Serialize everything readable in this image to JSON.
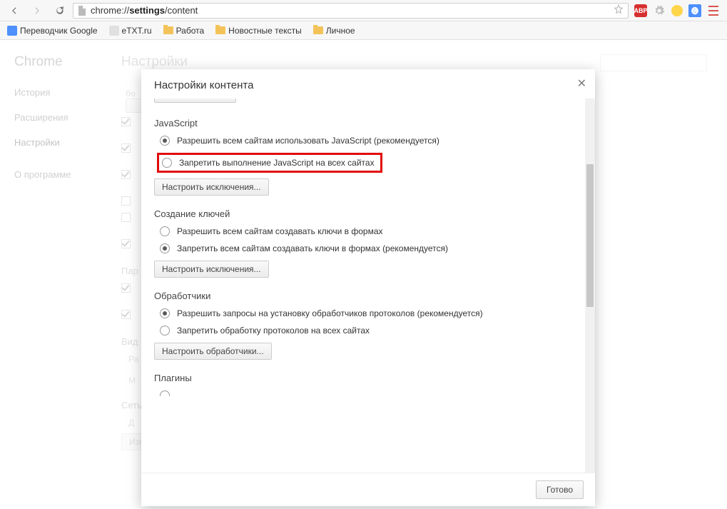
{
  "browser": {
    "url_prefix": "chrome://",
    "url_bold": "settings",
    "url_suffix": "/content",
    "ext_abp_label": "ABP",
    "ext_translate_label": "G"
  },
  "bookmarks": [
    {
      "name": "translator",
      "label": "Переводчик Google",
      "icon": "g"
    },
    {
      "name": "etxt",
      "label": "eTXT.ru",
      "icon": "e"
    },
    {
      "name": "work",
      "label": "Работа",
      "icon": "f"
    },
    {
      "name": "news",
      "label": "Новостные тексты",
      "icon": "f"
    },
    {
      "name": "personal",
      "label": "Личное",
      "icon": "f"
    }
  ],
  "page_bg": {
    "app_title": "Chrome",
    "page_header": "Настройки",
    "sidebar": {
      "history": "История",
      "extensions": "Расширения",
      "settings": "Настройки",
      "about": "О программе"
    },
    "sections": {
      "passwords": "Пар",
      "appearance": "Вид",
      "network": "Сеть"
    },
    "proxy_button": "Изменить настройки прокси-сервера...",
    "row_Pa": "Ра",
    "row_M": "М",
    "bo_label": "бо",
    "row_D": "Д"
  },
  "dialog": {
    "title": "Настройки контента",
    "done_btn": "Готово",
    "cutoff_btn_top": "",
    "sections": {
      "javascript": {
        "title": "JavaScript",
        "opt_allow": "Разрешить всем сайтам использовать JavaScript (рекомендуется)",
        "opt_block": "Запретить выполнение JavaScript на всех сайтах",
        "exceptions_btn": "Настроить исключения..."
      },
      "keys": {
        "title": "Создание ключей",
        "opt_allow": "Разрешить всем сайтам создавать ключи в формах",
        "opt_block": "Запретить всем сайтам создавать ключи в формах (рекомендуется)",
        "exceptions_btn": "Настроить исключения..."
      },
      "handlers": {
        "title": "Обработчики",
        "opt_allow": "Разрешить запросы на установку обработчиков протоколов (рекомендуется)",
        "opt_block": "Запретить обработку протоколов на всех сайтах",
        "exceptions_btn": "Настроить обработчики..."
      },
      "plugins": {
        "title": "Плагины"
      }
    }
  }
}
